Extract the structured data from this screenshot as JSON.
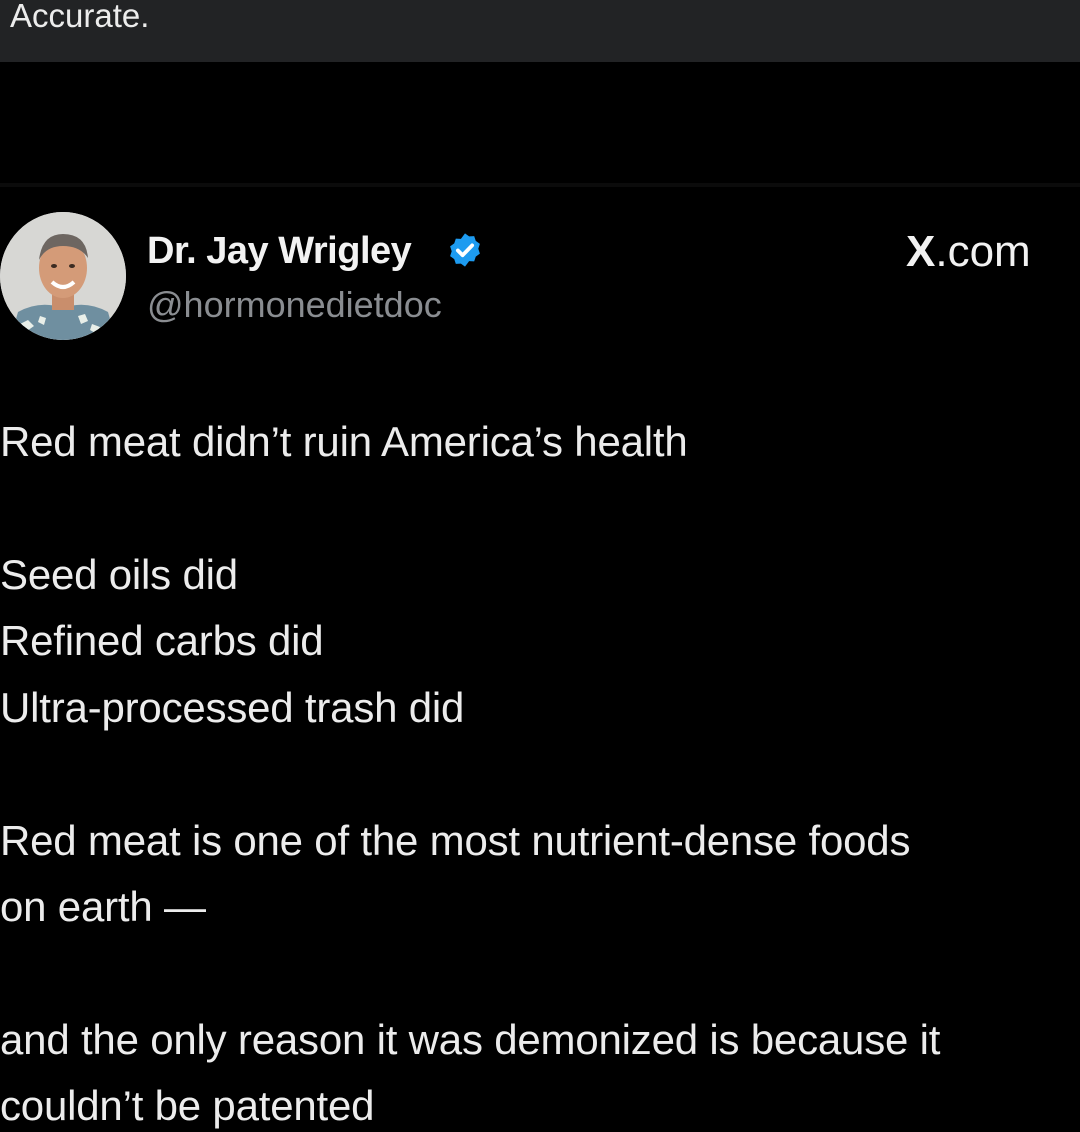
{
  "caption": "Accurate.",
  "tweet": {
    "author": {
      "display_name": "Dr. Jay Wrigley",
      "handle": "@hormonedietdoc",
      "verified": true
    },
    "source_brand": "X",
    "source_domain": ".com",
    "lines": [
      "Red meat didn’t ruin America’s health",
      "Seed oils did",
      "Refined carbs did",
      "Ultra-processed trash did",
      "Red meat is one of the most nutrient-dense foods",
      "on earth —",
      "and the only reason it was demonized is because it",
      "couldn’t be patented"
    ]
  },
  "colors": {
    "background": "#000000",
    "caption_bar": "#222325",
    "verified_badge": "#1d9bf0",
    "handle_text": "#8a8d91"
  },
  "icons": [
    "verified-badge-icon",
    "avatar"
  ]
}
